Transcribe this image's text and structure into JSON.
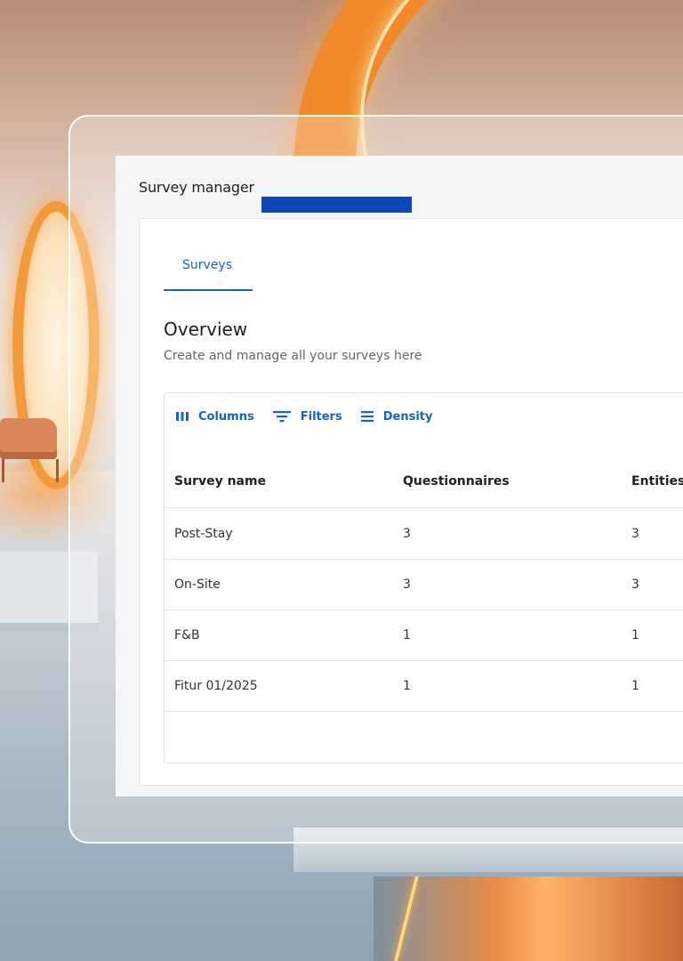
{
  "app": {
    "title": "Survey manager"
  },
  "tabs": [
    {
      "label": "Surveys",
      "active": true
    }
  ],
  "overview": {
    "title": "Overview",
    "subtitle": "Create and manage all your surveys here"
  },
  "toolbar": {
    "columns_label": "Columns",
    "filters_label": "Filters",
    "density_label": "Density"
  },
  "table": {
    "headers": [
      "Survey name",
      "Questionnaires",
      "Entities"
    ],
    "rows": [
      [
        "Post-Stay",
        "3",
        "3"
      ],
      [
        "On-Site",
        "3",
        "3"
      ],
      [
        "F&B",
        "1",
        "1"
      ],
      [
        "Fitur 01/2025",
        "1",
        "1"
      ]
    ]
  },
  "colors": {
    "accent": "#1565c0",
    "title_accent_bar": "#0d47b8",
    "glass_border": "#ffffff"
  },
  "icons": {
    "columns": "columns-icon",
    "filters": "filter-icon",
    "density": "density-icon"
  }
}
